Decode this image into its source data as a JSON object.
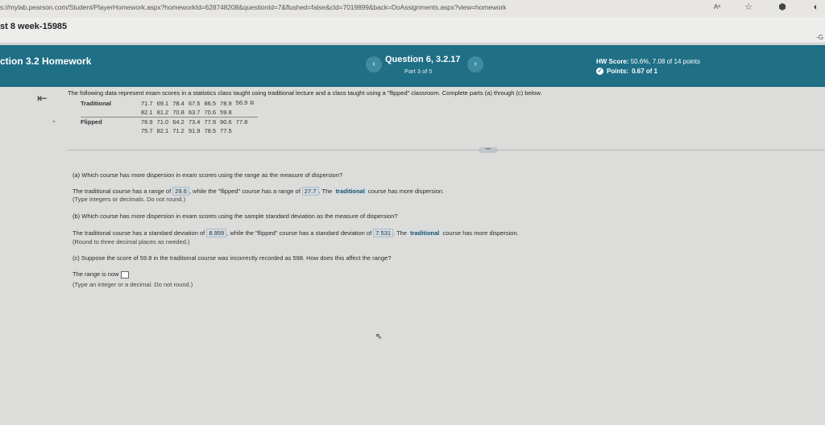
{
  "browser": {
    "url": "s://mylab.pearson.com/Student/PlayerHomework.aspx?homeworkId=628748208&questionId=7&flushed=false&cId=7019899&back=DoAssignments.aspx?view=homework",
    "font_icon": "Aᵃ",
    "star_icon": "star-icon",
    "ext_icon": "extension-icon"
  },
  "course": {
    "title": "st 8 week-15985",
    "right_fragment": "-G"
  },
  "header": {
    "section": "ction 3.2 Homework",
    "question": "Question 6, 3.2.17",
    "part": "Part 3 of 5",
    "hw_score_label": "HW Score:",
    "hw_score_value": "50.6%, 7.08 of 14 points",
    "points_label": "Points:",
    "points_value": "0.67 of 1",
    "prev_symbol": "‹",
    "next_symbol": "›"
  },
  "problem": {
    "intro": "The following data represent exam scores in a statistics class taught using traditional lecture and a class taught using a \"flipped\" classroom. Complete parts (a) through (c) below.",
    "traditional_label": "Traditional",
    "traditional_rows": [
      [
        "71.7",
        "69.1",
        "78.4",
        "67.5",
        "86.5",
        "78.9",
        "56.9"
      ],
      [
        "82.1",
        "81.2",
        "70.8",
        "63.7",
        "70.6",
        "59.8"
      ]
    ],
    "flipped_label": "Flipped",
    "flipped_rows": [
      [
        "76.9",
        "71.0",
        "64.2",
        "73.4",
        "77.9",
        "90.6",
        "77.8"
      ],
      [
        "75.7",
        "82.1",
        "71.2",
        "91.9",
        "78.5",
        "77.5"
      ]
    ]
  },
  "part_a": {
    "question": "(a) Which course has more dispersion in exam scores using the range as the measure of dispersion?",
    "pre": "The traditional course has a range of",
    "range_trad": "29.6",
    "mid": ", while the \"flipped\" course has a range of",
    "range_flip": "27.7",
    "post1": ". The",
    "selection": "traditional",
    "post2": "course has more dispersion.",
    "hint": "(Type integers or decimals. Do not round.)"
  },
  "part_b": {
    "question": "(b) Which course has more dispersion in exam scores using the sample standard deviation as the measure of dispersion?",
    "pre": "The traditional course has a standard deviation of",
    "sd_trad": "8.959",
    "mid": ", while the \"flipped\" course has a standard deviation of",
    "sd_flip": "7.531",
    "post1": ". The",
    "selection": "traditional",
    "post2": "course has more dispersion.",
    "hint": "(Round to three decimal places as needed.)"
  },
  "part_c": {
    "question": "(c) Suppose the score of 59.8 in the traditional course was incorrectly recorded as 598. How does this affect the range?",
    "prompt": "The range is now",
    "answer": "",
    "hint": "(Type an integer or a decimal. Do not round.)"
  }
}
